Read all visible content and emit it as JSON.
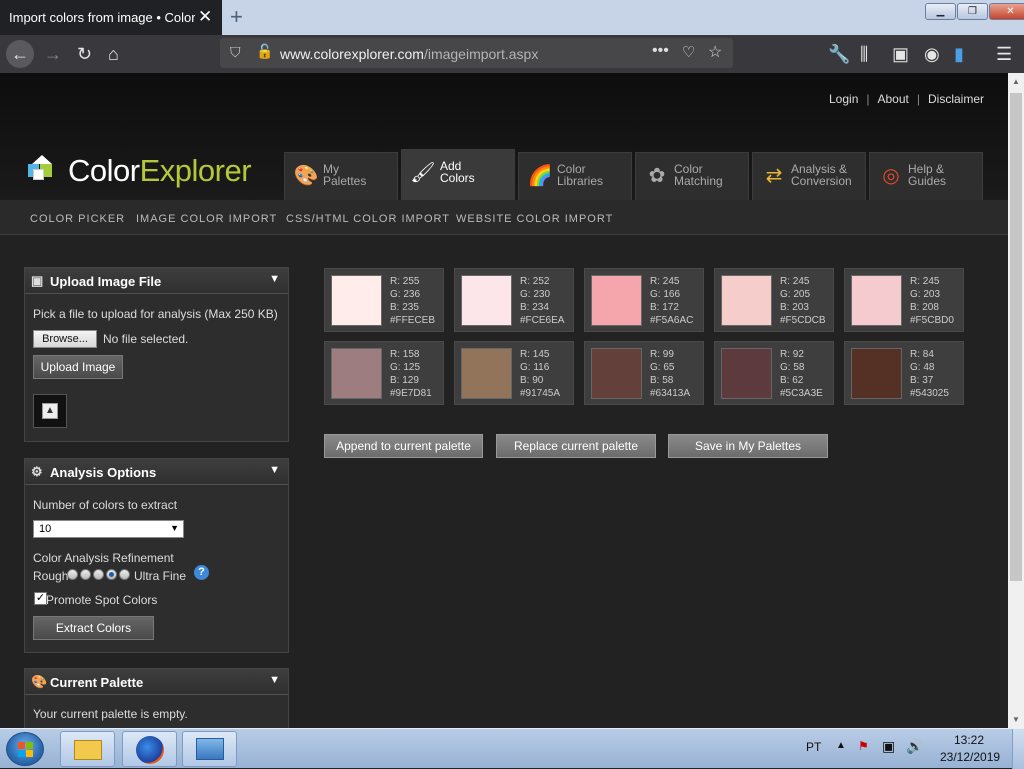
{
  "browser": {
    "tab_title": "Import colors from image • Color Explorer",
    "url_domain": "www.colorexplorer.com",
    "url_path": "/imageimport.aspx"
  },
  "top_links": [
    "Login",
    "About",
    "Disclaimer"
  ],
  "logo": {
    "part1": "Color",
    "part2": "Explorer"
  },
  "main_tabs": [
    {
      "line1": "My",
      "line2": "Palettes",
      "icon": "palette-icon"
    },
    {
      "line1": "Add",
      "line2": "Colors",
      "icon": "brush-icon"
    },
    {
      "line1": "Color",
      "line2": "Libraries",
      "icon": "swatch-fan-icon"
    },
    {
      "line1": "Color",
      "line2": "Matching",
      "icon": "flower-icon"
    },
    {
      "line1": "Analysis &",
      "line2": "Conversion",
      "icon": "convert-icon"
    },
    {
      "line1": "Help &",
      "line2": "Guides",
      "icon": "lifebuoy-icon"
    }
  ],
  "sub_nav": [
    "COLOR PICKER",
    "IMAGE COLOR IMPORT",
    "CSS/HTML COLOR IMPORT",
    "WEBSITE COLOR IMPORT"
  ],
  "upload_panel": {
    "title": "Upload Image File",
    "desc": "Pick a file to upload for analysis (Max 250 KB)",
    "browse_label": "Browse...",
    "file_status": "No file selected.",
    "upload_label": "Upload Image"
  },
  "analysis_panel": {
    "title": "Analysis Options",
    "num_label": "Number of colors to extract",
    "num_value": "10",
    "refine_label": "Color Analysis Refinement",
    "rough": "Rough",
    "fine": "Ultra Fine",
    "refinement_selected": 3,
    "spot_label": "Promote Spot Colors",
    "spot_checked": true,
    "extract_label": "Extract Colors"
  },
  "current_panel": {
    "title": "Current Palette",
    "text": "Your current palette is empty."
  },
  "swatches": [
    {
      "r": "R: 255",
      "g": "G: 236",
      "b": "B: 235",
      "hex": "#FFECEB",
      "color": "#FFECEB"
    },
    {
      "r": "R: 252",
      "g": "G: 230",
      "b": "B: 234",
      "hex": "#FCE6EA",
      "color": "#FCE6EA"
    },
    {
      "r": "R: 245",
      "g": "G: 166",
      "b": "B: 172",
      "hex": "#F5A6AC",
      "color": "#F5A6AC"
    },
    {
      "r": "R: 245",
      "g": "G: 205",
      "b": "B: 203",
      "hex": "#F5CDCB",
      "color": "#F5CDCB"
    },
    {
      "r": "R: 245",
      "g": "G: 203",
      "b": "B: 208",
      "hex": "#F5CBD0",
      "color": "#F5CBD0"
    },
    {
      "r": "R: 158",
      "g": "G: 125",
      "b": "B: 129",
      "hex": "#9E7D81",
      "color": "#9E7D81"
    },
    {
      "r": "R: 145",
      "g": "G: 116",
      "b": "B: 90",
      "hex": "#91745A",
      "color": "#91745A"
    },
    {
      "r": "R: 99",
      "g": "G: 65",
      "b": "B: 58",
      "hex": "#63413A",
      "color": "#63413A"
    },
    {
      "r": "R: 92",
      "g": "G: 58",
      "b": "B: 62",
      "hex": "#5C3A3E",
      "color": "#5C3A3E"
    },
    {
      "r": "R: 84",
      "g": "G: 48",
      "b": "B: 37",
      "hex": "#543025",
      "color": "#543025"
    }
  ],
  "actions": [
    "Append to current palette",
    "Replace current palette",
    "Save in My Palettes"
  ],
  "taskbar": {
    "lang": "PT",
    "time": "13:22",
    "date": "23/12/2019"
  }
}
